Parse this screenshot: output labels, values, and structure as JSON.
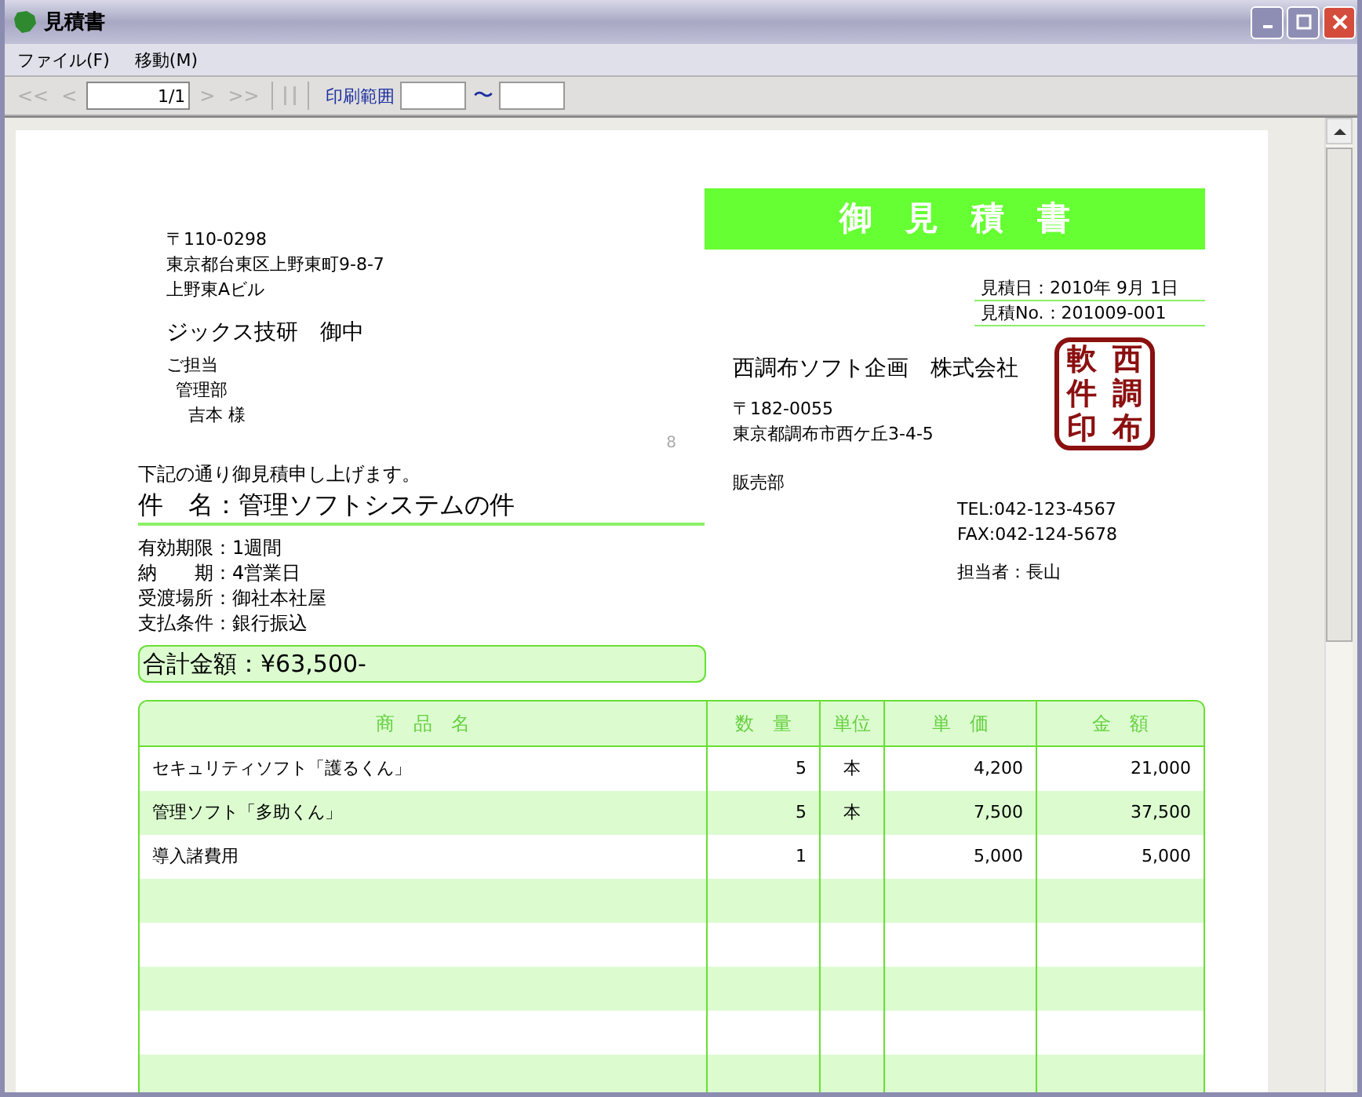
{
  "window": {
    "title": "見積書"
  },
  "menu": [
    {
      "label": "ファイル(F)"
    },
    {
      "label": "移動(M)"
    }
  ],
  "toolbar": {
    "nav": [
      {
        "label": "<<",
        "disabled": true
      },
      {
        "label": "<",
        "disabled": true
      }
    ],
    "page": "1/1",
    "nav_after": [
      {
        "label": ">",
        "disabled": true
      },
      {
        "label": ">>",
        "disabled": true
      }
    ],
    "print_range_label": "印刷範囲",
    "range_separator": "〜"
  },
  "document": {
    "title": "御　見　積　書",
    "recipient": {
      "postal": "〒110-0298",
      "address": "東京都台東区上野東町9-8-7",
      "building": "上野東Aビル",
      "company": "ジックス技研　御中",
      "contact_label": "ご担当",
      "department": "管理部",
      "person": "吉本 様"
    },
    "page_mark": "8",
    "estimate_date": "見積日：2010年 9月 1日",
    "estimate_no": "見積No.：201009-001",
    "issuer": {
      "company": "西調布ソフト企画　株式会社",
      "postal": "〒182-0055",
      "address": "東京都調布市西ケ丘3-4-5",
      "department": "販売部",
      "tel": "TEL:042-123-4567",
      "fax": "FAX:042-124-5678",
      "staff": "担当者：長山"
    },
    "seal": {
      "characters": [
        "軟",
        "西",
        "件",
        "調",
        "印",
        "布"
      ]
    },
    "intro": "下記の通り御見積申し上げます。",
    "subject": "件　名：管理ソフトシステムの件",
    "terms": [
      "有効期限：1週間",
      "納　　期：4営業日",
      "受渡場所：御社本社屋",
      "支払条件：銀行振込"
    ],
    "total": "合計金額：¥63,500-",
    "table": {
      "columns": [
        "商　品　名",
        "数　量",
        "単位",
        "単　価",
        "金　額"
      ],
      "rows": [
        [
          "セキュリティソフト「護るくん」",
          "5",
          "本",
          "4,200",
          "21,000"
        ],
        [
          "管理ソフト「多助くん」",
          "5",
          "本",
          "7,500",
          "37,500"
        ],
        [
          "導入諸費用",
          "1",
          "",
          "5,000",
          "5,000"
        ]
      ]
    }
  }
}
